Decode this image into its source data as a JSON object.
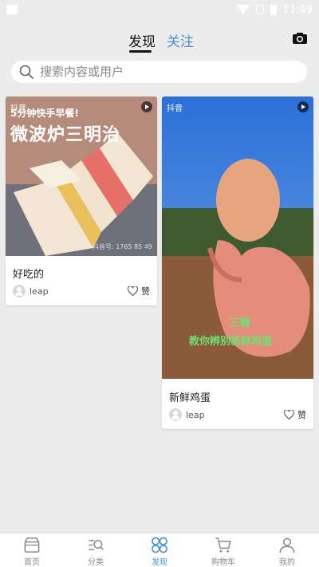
{
  "status_bar": {
    "time": "11:49"
  },
  "tabs": [
    {
      "label": "发现",
      "active": true
    },
    {
      "label": "关注",
      "active": false
    }
  ],
  "search": {
    "placeholder": "搜索内容或用户"
  },
  "posts": [
    {
      "title": "好吃的",
      "user": "leap",
      "like_label": "赞",
      "overlay_line1": "5分钟快手早餐!",
      "overlay_line2": "微波炉三明治",
      "source_mark": "抖音",
      "watermark": "抖音号: 1765 85 49"
    },
    {
      "title": "新鲜鸡蛋",
      "user": "leap",
      "like_label": "赞",
      "source_mark": "抖音",
      "subtitle_1": "三静",
      "subtitle_2": "教你辨别新鲜鸡蛋"
    }
  ],
  "bottom_nav": [
    {
      "label": "首页",
      "icon": "home-icon",
      "active": false
    },
    {
      "label": "分类",
      "icon": "category-icon",
      "active": false
    },
    {
      "label": "发现",
      "icon": "discover-icon",
      "active": true
    },
    {
      "label": "购物车",
      "icon": "cart-icon",
      "active": false
    },
    {
      "label": "我的",
      "icon": "profile-icon",
      "active": false
    }
  ],
  "colors": {
    "accent": "#4a8fd4",
    "background": "#ececec"
  }
}
